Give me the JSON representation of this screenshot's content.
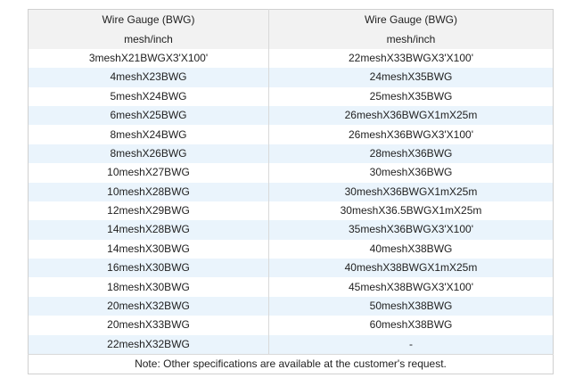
{
  "table": {
    "header": {
      "row1": [
        "Wire Gauge (BWG)",
        "Wire Gauge (BWG)"
      ],
      "row2": [
        "mesh/inch",
        "mesh/inch"
      ]
    },
    "rows": [
      [
        "3meshX21BWGX3'X100'",
        "22meshX33BWGX3'X100'"
      ],
      [
        "4meshX23BWG",
        "24meshX35BWG"
      ],
      [
        "5meshX24BWG",
        "25meshX35BWG"
      ],
      [
        "6meshX25BWG",
        "26meshX36BWGX1mX25m"
      ],
      [
        "8meshX24BWG",
        "26meshX36BWGX3'X100'"
      ],
      [
        "8meshX26BWG",
        "28meshX36BWG"
      ],
      [
        "10meshX27BWG",
        "30meshX36BWG"
      ],
      [
        "10meshX28BWG",
        "30meshX36BWGX1mX25m"
      ],
      [
        "12meshX29BWG",
        "30meshX36.5BWGX1mX25m"
      ],
      [
        "14meshX28BWG",
        "35meshX36BWGX3'X100'"
      ],
      [
        "14meshX30BWG",
        "40meshX38BWG"
      ],
      [
        "16meshX30BWG",
        "40meshX38BWGX1mX25m"
      ],
      [
        "18meshX30BWG",
        "45meshX38BWGX3'X100'"
      ],
      [
        "20meshX32BWG",
        "50meshX38BWG"
      ],
      [
        "20meshX33BWG",
        "60meshX38BWG"
      ],
      [
        "22meshX32BWG",
        "-"
      ]
    ],
    "note": "Note: Other specifications are available at the customer's request.",
    "colors": {
      "header_bg": "#f2f2f2",
      "stripe_bg": "#eaf4fc",
      "border": "#d0d0d0"
    }
  }
}
